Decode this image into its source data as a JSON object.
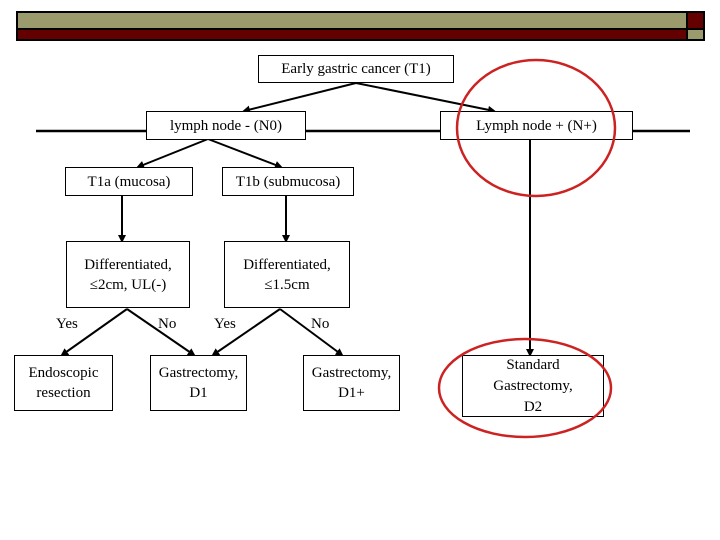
{
  "theme": {
    "header_bar_color": "#9a9a6c",
    "header_accent_color": "#650000",
    "highlight_circle_color": "#cc2222"
  },
  "diagram": {
    "title_node": "Early gastric cancer (T1)",
    "nodes": {
      "n0": "lymph node - (N0)",
      "nplus": "Lymph node + (N+)",
      "t1a": "T1a (mucosa)",
      "t1b": "T1b (submucosa)",
      "diff_a": "Differentiated,\n≤2cm, UL(-)",
      "diff_b": "Differentiated,\n≤1.5cm",
      "endoscopic": "Endoscopic\nresection",
      "gastro_d1": "Gastrectomy,\nD1",
      "gastro_d1plus": "Gastrectomy,\nD1+",
      "standard": "Standard\nGastrectomy,\nD2"
    },
    "branch_labels": {
      "a_yes": "Yes",
      "a_no": "No",
      "b_yes": "Yes",
      "b_no": "No"
    },
    "highlighted": [
      "Lymph node + (N+)",
      "Standard Gastrectomy, D2"
    ]
  }
}
